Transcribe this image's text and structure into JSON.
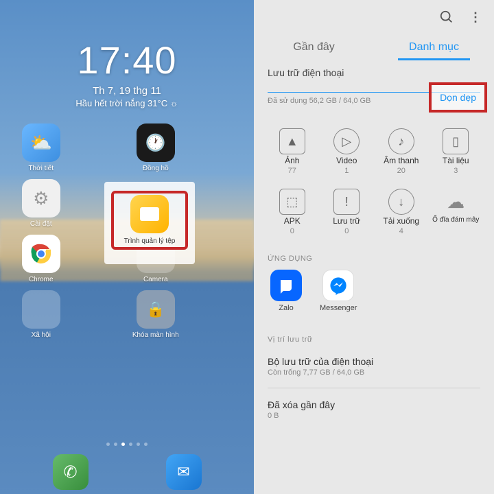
{
  "homescreen": {
    "time": "17:40",
    "date": "Th 7, 19 thg 11",
    "weather": "Hầu hết trời nắng 31°C ☼",
    "apps": {
      "weather": "Thời tiết",
      "clock": "Đồng hồ",
      "settings": "Cài đặt",
      "files": "Trình quản lý tệp",
      "chrome": "Chrome",
      "camera": "Camera",
      "social": "Xã hội",
      "lock": "Khóa màn hình"
    }
  },
  "fm": {
    "tabs": {
      "recent": "Gần đây",
      "categories": "Danh mục"
    },
    "storage_title": "Lưu trữ điện thoại",
    "storage_used": "Đã sử dụng 56,2 GB / 64,0 GB",
    "cleanup": "Dọn dẹp",
    "cats": [
      {
        "label": "Ảnh",
        "count": "77"
      },
      {
        "label": "Video",
        "count": "1"
      },
      {
        "label": "Âm thanh",
        "count": "20"
      },
      {
        "label": "Tài liệu",
        "count": "3"
      },
      {
        "label": "APK",
        "count": "0"
      },
      {
        "label": "Lưu trữ",
        "count": "0"
      },
      {
        "label": "Tải xuống",
        "count": "4"
      },
      {
        "label": "Ổ đĩa đám mây",
        "count": ""
      }
    ],
    "apps_header": "ỨNG DỤNG",
    "apps": {
      "zalo": "Zalo",
      "messenger": "Messenger"
    },
    "loc_header": "Vị trí lưu trữ",
    "phone_storage": "Bộ lưu trữ của điện thoại",
    "phone_free": "Còn trống 7,77 GB / 64,0 GB",
    "deleted_title": "Đã xóa gần đây",
    "deleted_size": "0 B"
  }
}
